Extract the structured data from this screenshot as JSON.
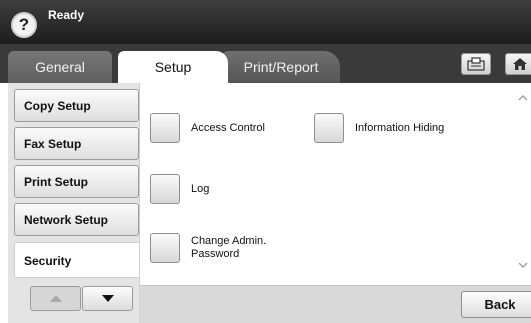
{
  "status": {
    "help_symbol": "?",
    "text": "Ready"
  },
  "tabs": [
    {
      "label": "General"
    },
    {
      "label": "Setup"
    },
    {
      "label": "Print/Report"
    }
  ],
  "toolbar": {
    "jobs_icon": "job-status-icon",
    "home_icon": "home-icon"
  },
  "sidebar": {
    "items": [
      {
        "label": "Copy Setup"
      },
      {
        "label": "Fax Setup"
      },
      {
        "label": "Print Setup"
      },
      {
        "label": "Network Setup"
      },
      {
        "label": "Security"
      }
    ],
    "active": "Security"
  },
  "options": [
    {
      "label": "Access Control"
    },
    {
      "label": "Information Hiding"
    },
    {
      "label": "Log"
    },
    {
      "label": "Change Admin. Password"
    }
  ],
  "footer": {
    "back_label": "Back"
  }
}
